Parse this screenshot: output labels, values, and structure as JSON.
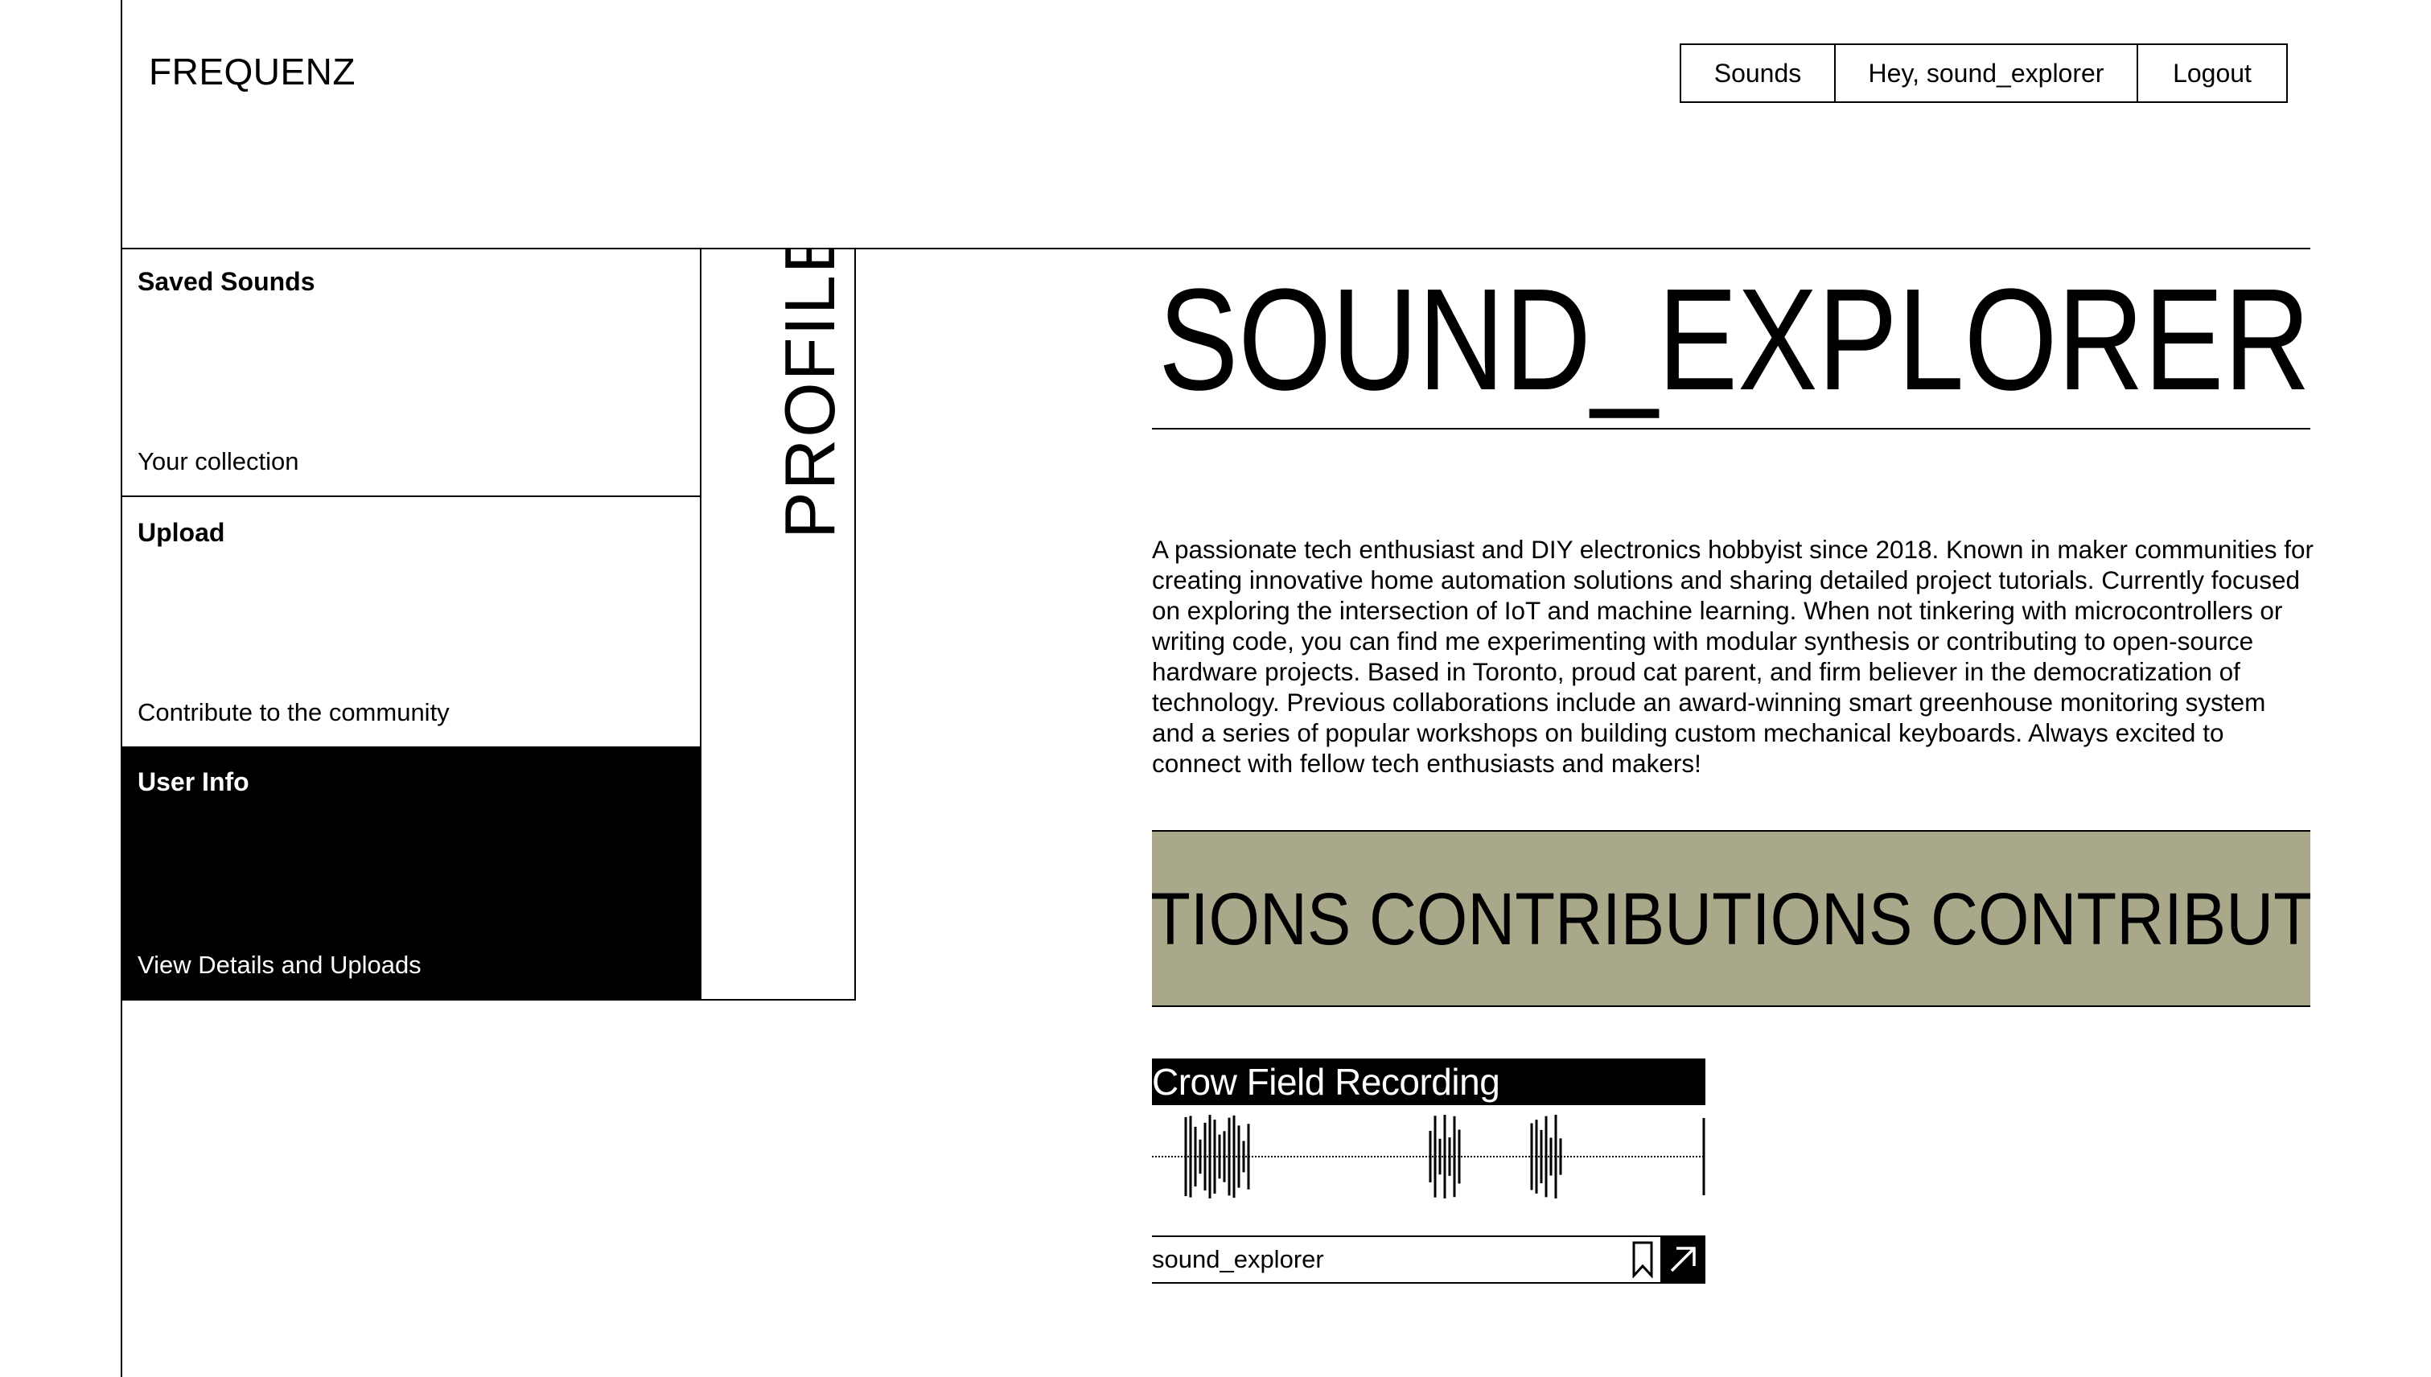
{
  "brand": {
    "logo": "FREQUENZ"
  },
  "nav": {
    "sounds": "Sounds",
    "greeting": "Hey, sound_explorer",
    "logout": "Logout"
  },
  "sidebar": {
    "cards": [
      {
        "title": "Saved Sounds",
        "subtitle": "Your collection",
        "active": false
      },
      {
        "title": "Upload",
        "subtitle": "Contribute to the community",
        "active": false
      },
      {
        "title": "User Info",
        "subtitle": "View Details and Uploads",
        "active": true
      }
    ],
    "vertical_label": "PROFILE"
  },
  "profile": {
    "username": "SOUND_EXPLORER",
    "bio": "A passionate tech enthusiast and DIY electronics hobbyist since 2018. Known in maker communities for creating innovative home automation solutions and sharing detailed project tutorials. Currently focused on exploring the intersection of IoT and machine learning. When not tinkering with microcontrollers or writing code, you can find me experimenting with modular synthesis or contributing to open-source hardware projects. Based in Toronto, proud cat parent, and firm believer in the democratization of technology. Previous collaborations include an award-winning smart greenhouse monitoring system and a series of popular workshops on building custom mechanical keyboards. Always excited to connect with fellow tech enthusiasts and makers!"
  },
  "contributions": {
    "marquee_text": "TIONS CONTRIBUTIONS CONTRIBUT"
  },
  "sound": {
    "title": "Crow Field Recording",
    "author": "sound_explorer",
    "bookmark_icon": "bookmark-icon",
    "open_icon": "arrow-up-right-icon"
  },
  "colors": {
    "accent": "#aaa88a",
    "ink": "#000000",
    "paper": "#ffffff"
  }
}
